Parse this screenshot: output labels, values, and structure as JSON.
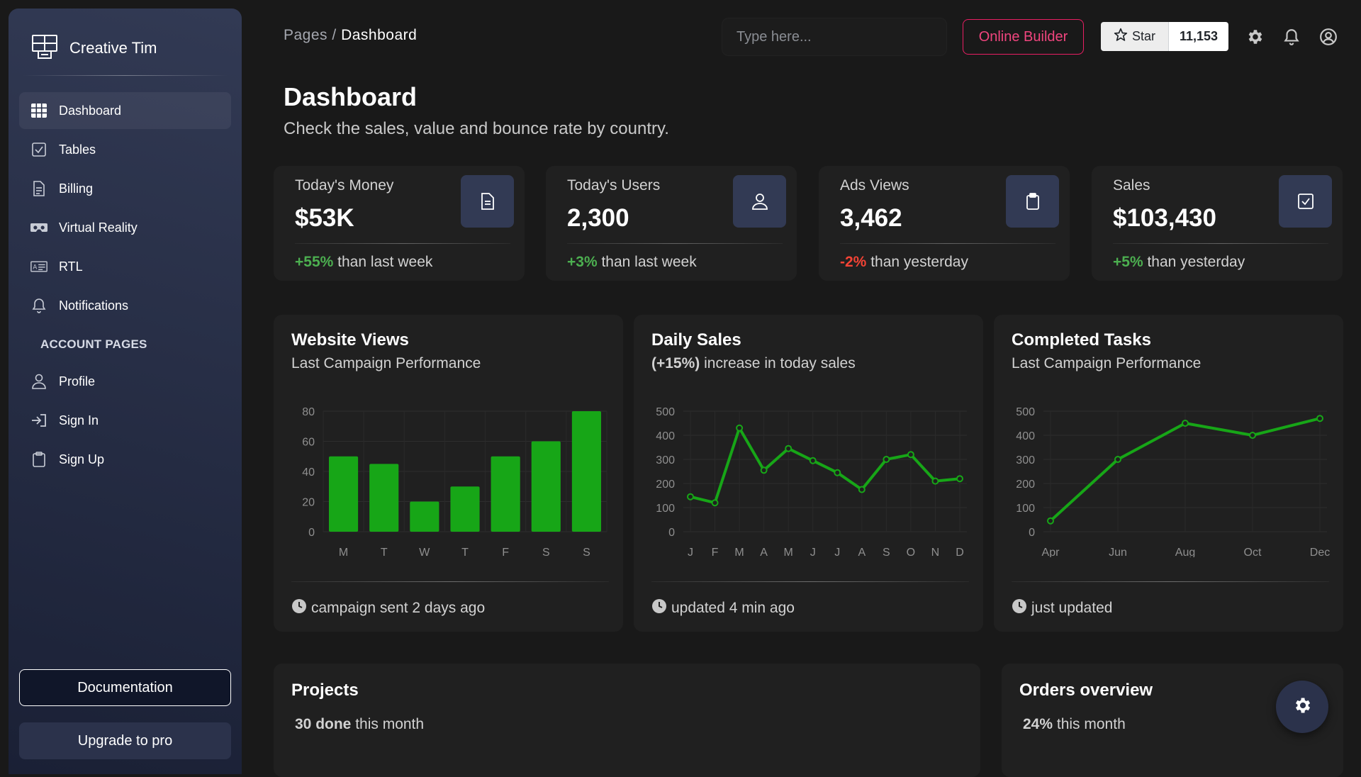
{
  "sidebar": {
    "brand": "Creative Tim",
    "items": [
      {
        "label": "Dashboard",
        "icon": "dashboard-grid-icon"
      },
      {
        "label": "Tables",
        "icon": "table-icon"
      },
      {
        "label": "Billing",
        "icon": "receipt-icon"
      },
      {
        "label": "Virtual Reality",
        "icon": "vr-headset-icon"
      },
      {
        "label": "RTL",
        "icon": "id-card-icon"
      },
      {
        "label": "Notifications",
        "icon": "bell-icon"
      }
    ],
    "section": "ACCOUNT PAGES",
    "account_items": [
      {
        "label": "Profile",
        "icon": "person-icon"
      },
      {
        "label": "Sign In",
        "icon": "login-icon"
      },
      {
        "label": "Sign Up",
        "icon": "clipboard-icon"
      }
    ],
    "documentation": "Documentation",
    "upgrade": "Upgrade to pro"
  },
  "topbar": {
    "breadcrumb_parent": "Pages",
    "breadcrumb_sep": " / ",
    "breadcrumb_current": "Dashboard",
    "search_placeholder": "Type here...",
    "online_builder": "Online Builder",
    "star_label": "Star",
    "star_count": "11,153"
  },
  "header": {
    "title": "Dashboard",
    "subtitle": "Check the sales, value and bounce rate by country."
  },
  "stats": [
    {
      "label": "Today's Money",
      "value": "$53K",
      "change": "+55%",
      "suffix": " than last week",
      "trend": "up",
      "icon": "document-icon"
    },
    {
      "label": "Today's Users",
      "value": "2,300",
      "change": "+3%",
      "suffix": " than last week",
      "trend": "up",
      "icon": "user-icon"
    },
    {
      "label": "Ads Views",
      "value": "3,462",
      "change": "-2%",
      "suffix": " than yesterday",
      "trend": "down",
      "icon": "clipboard-icon"
    },
    {
      "label": "Sales",
      "value": "$103,430",
      "change": "+5%",
      "suffix": " than yesterday",
      "trend": "up",
      "icon": "checkbox-icon"
    }
  ],
  "charts": [
    {
      "title": "Website Views",
      "subtitle_bold": "",
      "subtitle": "Last Campaign Performance",
      "footer": "campaign sent 2 days ago"
    },
    {
      "title": "Daily Sales",
      "subtitle_bold": "(+15%)",
      "subtitle": " increase in today sales",
      "footer": "updated 4 min ago"
    },
    {
      "title": "Completed Tasks",
      "subtitle_bold": "",
      "subtitle": "Last Campaign Performance",
      "footer": "just updated"
    }
  ],
  "chart_data": [
    {
      "type": "bar",
      "categories": [
        "M",
        "T",
        "W",
        "T",
        "F",
        "S",
        "S"
      ],
      "values": [
        50,
        45,
        20,
        30,
        50,
        60,
        80
      ],
      "ylim": [
        0,
        80
      ],
      "yticks": [
        0,
        20,
        40,
        60,
        80
      ],
      "grid": true,
      "color": "#17a617"
    },
    {
      "type": "line",
      "categories": [
        "J",
        "F",
        "M",
        "A",
        "M",
        "J",
        "J",
        "A",
        "S",
        "O",
        "N",
        "D"
      ],
      "values": [
        145,
        120,
        430,
        255,
        345,
        295,
        245,
        175,
        300,
        320,
        210,
        220
      ],
      "ylim": [
        0,
        500
      ],
      "yticks": [
        0,
        100,
        200,
        300,
        400,
        500
      ],
      "grid": true,
      "color": "#17a617"
    },
    {
      "type": "line",
      "categories": [
        "Apr",
        "Jun",
        "Aug",
        "Oct",
        "Dec"
      ],
      "values": [
        45,
        300,
        450,
        400,
        470
      ],
      "ylim": [
        0,
        500
      ],
      "yticks": [
        0,
        100,
        200,
        300,
        400,
        500
      ],
      "grid": true,
      "color": "#17a617"
    }
  ],
  "projects": {
    "title": "Projects",
    "done": "30 done",
    "suffix": " this month"
  },
  "orders": {
    "title": "Orders overview",
    "percent": "24%",
    "suffix": " this month"
  },
  "colors": {
    "accent": "#e91e63",
    "success": "#4caf50",
    "danger": "#f44335",
    "chart": "#17a617",
    "sidebar": "#323a54"
  }
}
